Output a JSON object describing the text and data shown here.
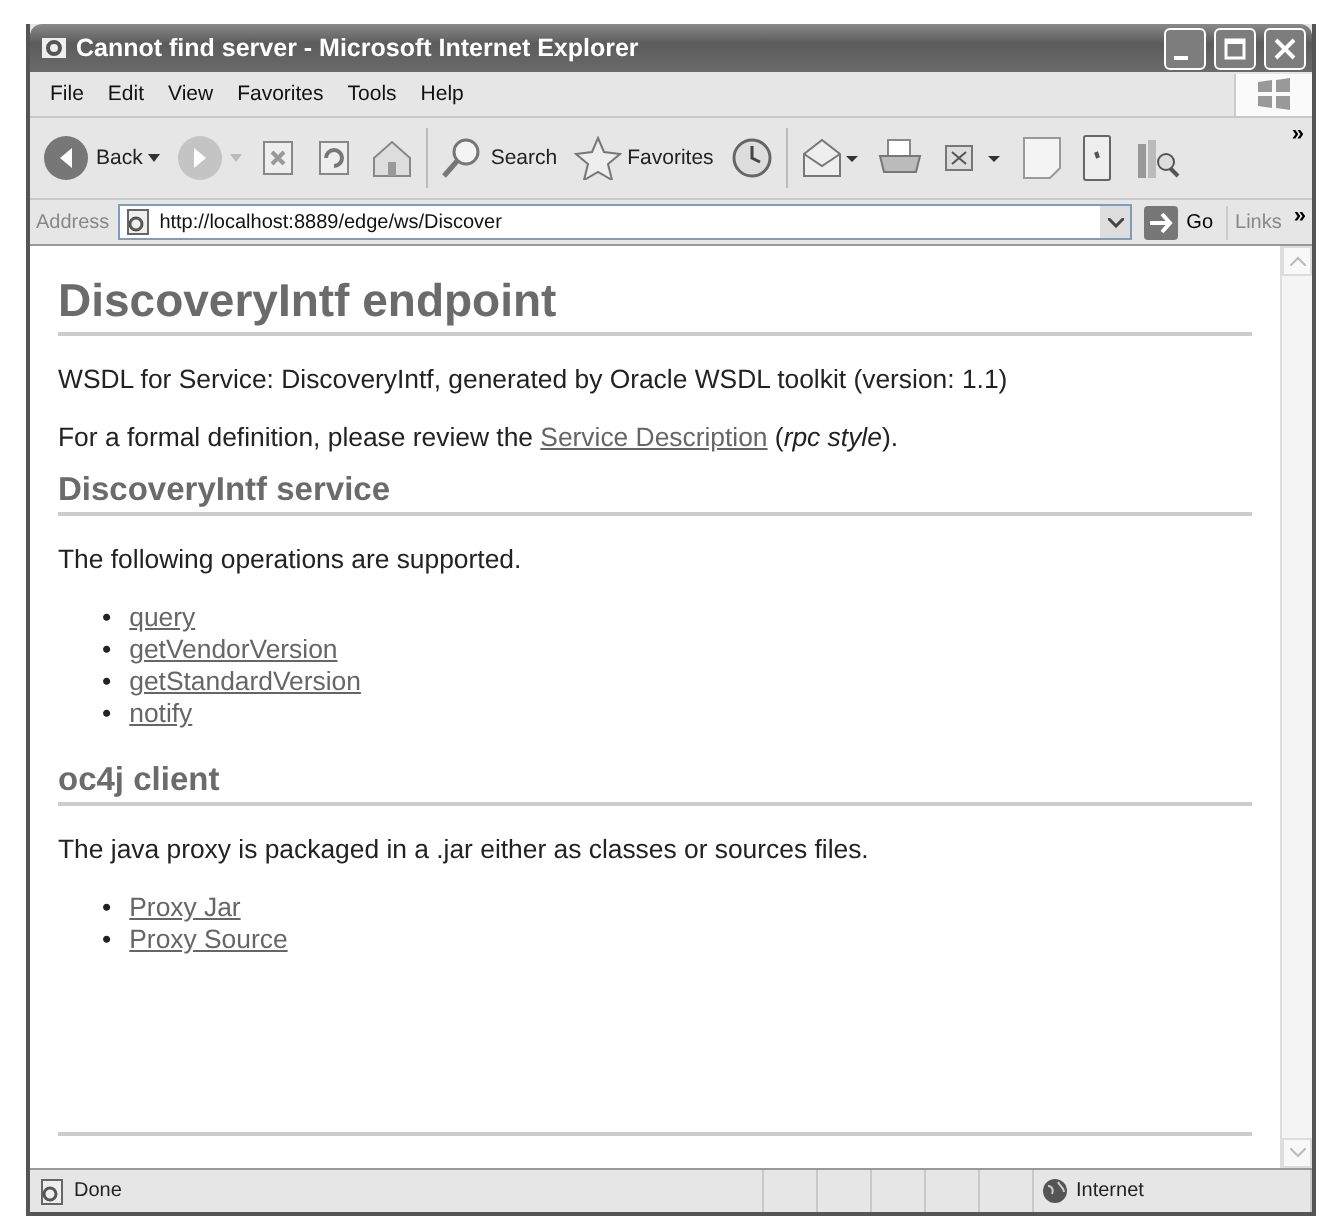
{
  "window": {
    "title": "Cannot find server - Microsoft Internet Explorer"
  },
  "menu": [
    "File",
    "Edit",
    "View",
    "Favorites",
    "Tools",
    "Help"
  ],
  "toolbar": [
    {
      "kind": "back",
      "label": "Back"
    },
    {
      "kind": "forward"
    },
    {
      "kind": "stop"
    },
    {
      "kind": "refresh"
    },
    {
      "kind": "home"
    },
    {
      "kind": "search",
      "label": "Search"
    },
    {
      "kind": "favorites",
      "label": "Favorites"
    },
    {
      "kind": "history"
    },
    {
      "kind": "mail"
    },
    {
      "kind": "print"
    },
    {
      "kind": "edit"
    },
    {
      "kind": "blank"
    },
    {
      "kind": "messenger"
    },
    {
      "kind": "research"
    }
  ],
  "toolbar_more": "»",
  "address": {
    "label": "Address",
    "url": "http://localhost:8889/edge/ws/Discover",
    "go": "Go",
    "links": "Links",
    "links_more": "»"
  },
  "page": {
    "title": "DiscoveryIntf endpoint",
    "intro": "WSDL for Service: DiscoveryIntf, generated by Oracle WSDL toolkit (version: 1.1)",
    "definition": {
      "before": "For a formal definition, please review the ",
      "link": "Service Description",
      "after": " (*rpc style*)."
    },
    "sections": [
      {
        "heading": "DiscoveryIntf service",
        "text": "The following operations are supported.",
        "links": [
          {
            "marker": "•",
            "label": "query"
          },
          {
            "marker": "•",
            "label": "getVendorVersion"
          },
          {
            "marker": "•",
            "label": "getStandardVersion"
          },
          {
            "marker": "•",
            "label": "notify"
          }
        ]
      },
      {
        "heading": "oc4j client",
        "text": "The java proxy is packaged in a .jar either as classes or sources files.",
        "links": [
          {
            "marker": "•",
            "label": "Proxy Jar"
          },
          {
            "marker": "•",
            "label": "Proxy Source"
          }
        ]
      }
    ]
  },
  "status_bar": {
    "text": "Done",
    "zone": "Internet"
  }
}
